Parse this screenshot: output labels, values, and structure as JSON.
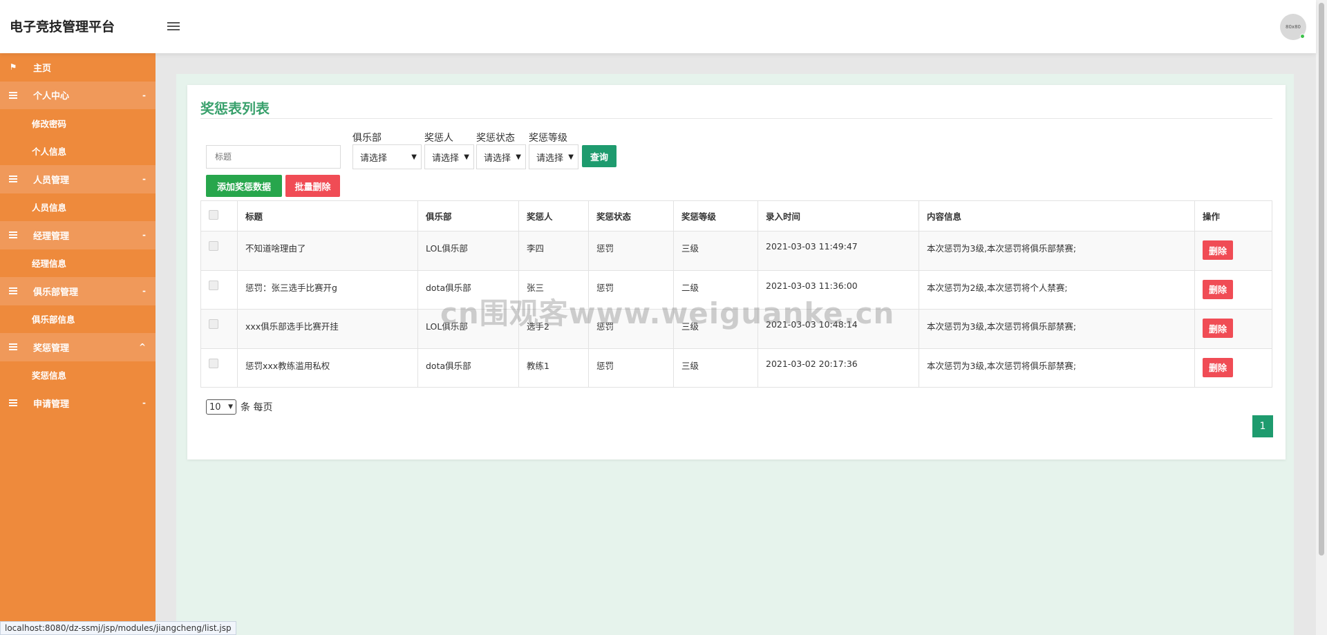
{
  "header": {
    "brand": "电子竞技管理平台",
    "avatar_text": "80x80"
  },
  "sidebar": {
    "home": "主页",
    "groups": [
      {
        "label": "个人中心",
        "items": [
          "修改密码",
          "个人信息"
        ]
      },
      {
        "label": "人员管理",
        "items": [
          "人员信息"
        ]
      },
      {
        "label": "经理管理",
        "items": [
          "经理信息"
        ]
      },
      {
        "label": "俱乐部管理",
        "items": [
          "俱乐部信息"
        ]
      },
      {
        "label": "奖惩管理",
        "items": [
          "奖惩信息"
        ]
      },
      {
        "label": "申请管理",
        "items": []
      }
    ]
  },
  "page": {
    "title": "奖惩表列表",
    "filters": {
      "title_placeholder": "标题",
      "club_label": "俱乐部",
      "person_label": "奖惩人",
      "status_label": "奖惩状态",
      "level_label": "奖惩等级",
      "select_value": "请选择",
      "query": "查询"
    },
    "actions": {
      "add": "添加奖惩数据",
      "batch_delete": "批量删除"
    },
    "table": {
      "headers": [
        "标题",
        "俱乐部",
        "奖惩人",
        "奖惩状态",
        "奖惩等级",
        "录入时间",
        "内容信息",
        "操作"
      ],
      "rows": [
        [
          "不知道啥理由了",
          "LOL俱乐部",
          "李四",
          "惩罚",
          "三级",
          "2021-03-03 11:49:47",
          "本次惩罚为3级,本次惩罚将俱乐部禁赛;"
        ],
        [
          "惩罚：张三选手比赛开g",
          "dota俱乐部",
          "张三",
          "惩罚",
          "二级",
          "2021-03-03 11:36:00",
          "本次惩罚为2级,本次惩罚将个人禁赛;"
        ],
        [
          "xxx俱乐部选手比赛开挂",
          "LOL俱乐部",
          "选手2",
          "惩罚",
          "三级",
          "2021-03-03 10:48:14",
          "本次惩罚为3级,本次惩罚将俱乐部禁赛;"
        ],
        [
          "惩罚xxx教练滥用私权",
          "dota俱乐部",
          "教练1",
          "惩罚",
          "三级",
          "2021-03-02 20:17:36",
          "本次惩罚为3级,本次惩罚将俱乐部禁赛;"
        ]
      ],
      "delete_label": "删除"
    },
    "pagination": {
      "page_size": "10",
      "per_page_label": "条 每页",
      "current_page": "1"
    }
  },
  "watermark": "cn围观客www.weiguanke.cn",
  "status_bar": "localhost:8080/dz-ssmj/jsp/modules/jiangcheng/list.jsp"
}
